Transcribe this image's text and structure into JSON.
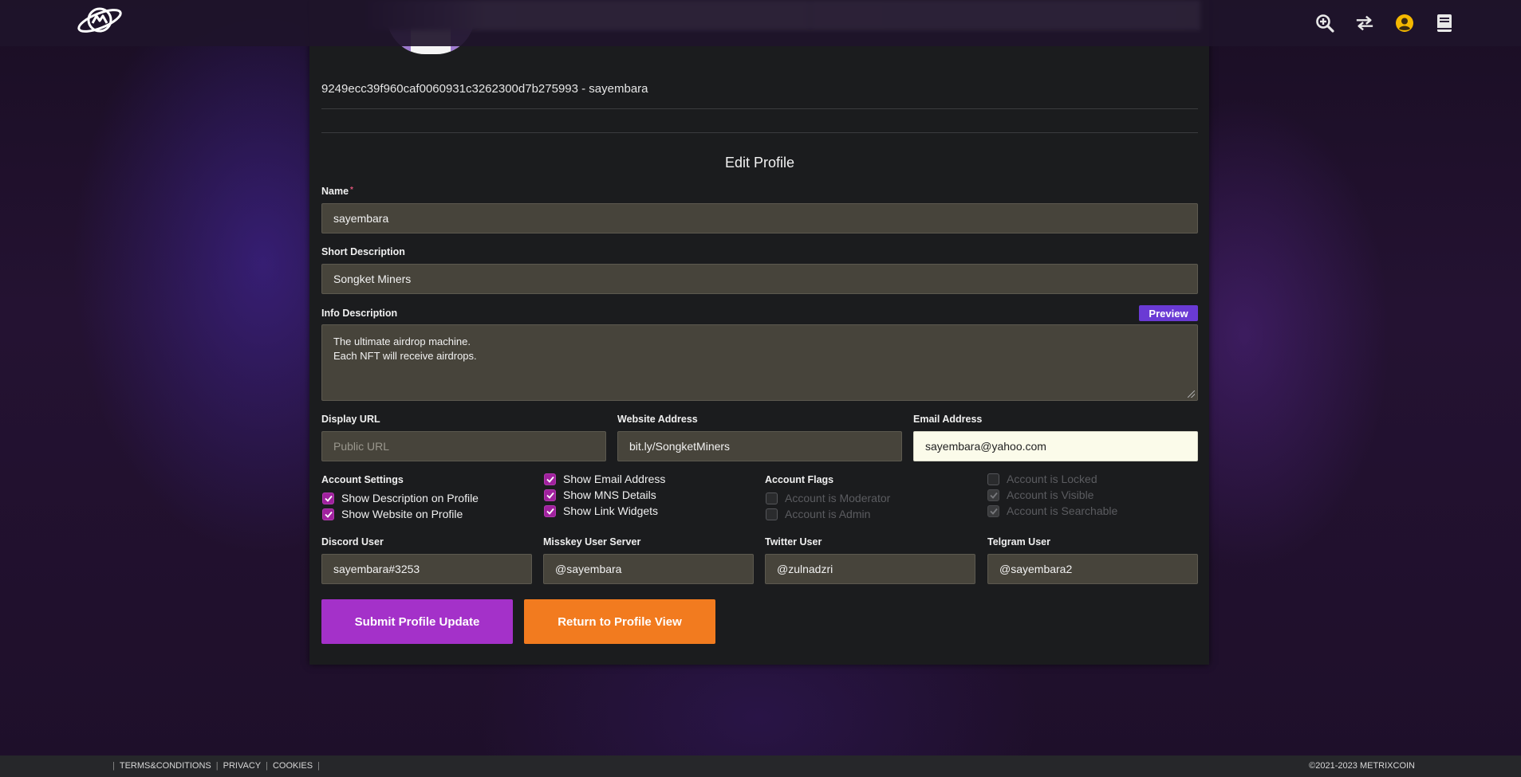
{
  "header": {
    "logo_icon": "metrixcoin-planet-logo",
    "icons": [
      {
        "name": "search-plus-icon"
      },
      {
        "name": "swap-arrows-icon"
      },
      {
        "name": "user-circle-icon",
        "color": "#f5b800"
      },
      {
        "name": "book-icon"
      }
    ]
  },
  "profile": {
    "wallet_line": "9249ecc39f960caf0060931c3262300d7b275993 - sayembara"
  },
  "form": {
    "title": "Edit Profile",
    "name": {
      "label": "Name",
      "required_mark": "*",
      "value": "sayembara"
    },
    "short_description": {
      "label": "Short Description",
      "value": "Songket Miners"
    },
    "info_description": {
      "label": "Info Description",
      "preview_label": "Preview",
      "value": "The ultimate airdrop machine.\nEach NFT will receive airdrops."
    },
    "display_url": {
      "label": "Display URL",
      "value": "",
      "placeholder": "Public URL"
    },
    "website_address": {
      "label": "Website Address",
      "value": "bit.ly/SongketMiners"
    },
    "email_address": {
      "label": "Email Address",
      "value": "sayembara@yahoo.com"
    },
    "account_settings": {
      "label": "Account Settings",
      "options": [
        {
          "label": "Show Description on Profile",
          "checked": true
        },
        {
          "label": "Show Website on Profile",
          "checked": true
        },
        {
          "label": "Show Email Address",
          "checked": true
        },
        {
          "label": "Show MNS Details",
          "checked": true
        },
        {
          "label": "Show Link Widgets",
          "checked": true
        }
      ]
    },
    "account_flags": {
      "label": "Account Flags",
      "options": [
        {
          "label": "Account is Moderator",
          "checked": false,
          "disabled": true
        },
        {
          "label": "Account is Admin",
          "checked": false,
          "disabled": true
        },
        {
          "label": "Account is Locked",
          "checked": false,
          "disabled": true
        },
        {
          "label": "Account is Visible",
          "checked": true,
          "disabled": true
        },
        {
          "label": "Account is Searchable",
          "checked": true,
          "disabled": true
        }
      ]
    },
    "discord_user": {
      "label": "Discord User",
      "value": "sayembara#3253"
    },
    "misskey_user": {
      "label": "Misskey User Server",
      "value": "@sayembara"
    },
    "twitter_user": {
      "label": "Twitter User",
      "value": "@zulnadzri"
    },
    "telegram_user": {
      "label": "Telgram User",
      "value": "@sayembara2"
    },
    "submit_label": "Submit Profile Update",
    "return_label": "Return to Profile View"
  },
  "footer": {
    "links": [
      "TERMS&CONDITIONS",
      "PRIVACY",
      "COOKIES"
    ],
    "separator": "|",
    "copyright": "©2021-2023 METRIXCOIN"
  },
  "colors": {
    "accent_purple": "#a431c9",
    "accent_orange": "#f27b1f",
    "preview_purple": "#6a3ad4",
    "checkbox_purple": "#a0219e"
  }
}
